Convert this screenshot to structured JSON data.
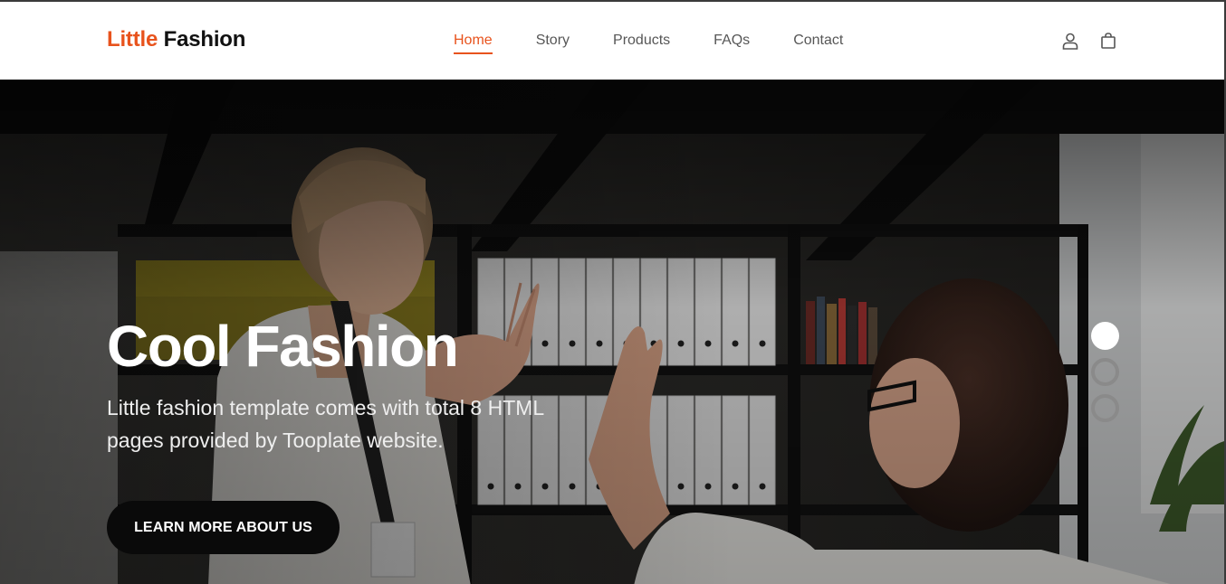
{
  "brand": {
    "accent": "Little",
    "rest": "Fashion"
  },
  "nav": {
    "items": [
      {
        "label": "Home",
        "active": true
      },
      {
        "label": "Story",
        "active": false
      },
      {
        "label": "Products",
        "active": false
      },
      {
        "label": "FAQs",
        "active": false
      },
      {
        "label": "Contact",
        "active": false
      }
    ],
    "icons": [
      "user-icon",
      "shopping-bag-icon"
    ]
  },
  "hero": {
    "title": "Cool Fashion",
    "text": "Little fashion template comes with total 8 HTML pages provided by Tooplate website.",
    "button_label": "LEARN MORE ABOUT US",
    "slide_count": 3,
    "active_slide": 1
  },
  "colors": {
    "accent": "#e8531d",
    "button": "#0a0a0a",
    "text_dark": "#111111",
    "nav_text": "#575757"
  }
}
